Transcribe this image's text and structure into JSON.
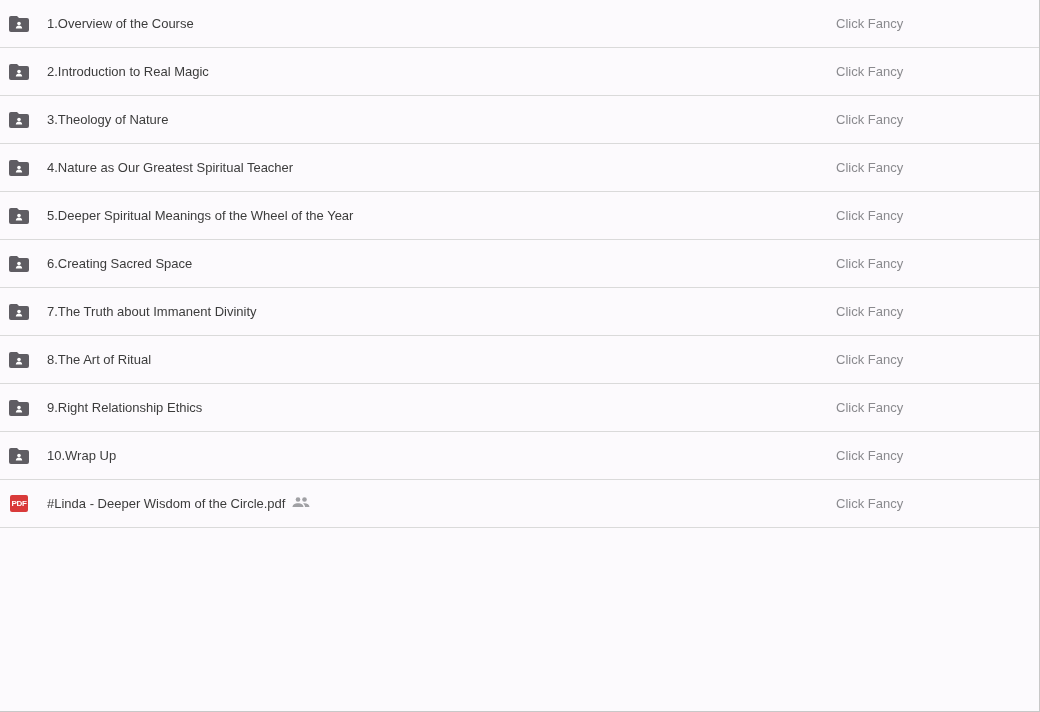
{
  "files": [
    {
      "kind": "folder",
      "name": "1.Overview of the Course",
      "owner": "Click Fancy",
      "shared": false
    },
    {
      "kind": "folder",
      "name": "2.Introduction to Real Magic",
      "owner": "Click Fancy",
      "shared": false
    },
    {
      "kind": "folder",
      "name": "3.Theology of Nature",
      "owner": "Click Fancy",
      "shared": false
    },
    {
      "kind": "folder",
      "name": "4.Nature as Our Greatest Spiritual Teacher",
      "owner": "Click Fancy",
      "shared": false
    },
    {
      "kind": "folder",
      "name": "5.Deeper Spiritual Meanings of the Wheel of the Year",
      "owner": "Click Fancy",
      "shared": false
    },
    {
      "kind": "folder",
      "name": "6.Creating Sacred Space",
      "owner": "Click Fancy",
      "shared": false
    },
    {
      "kind": "folder",
      "name": "7.The Truth about Immanent Divinity",
      "owner": "Click Fancy",
      "shared": false
    },
    {
      "kind": "folder",
      "name": "8.The Art of Ritual",
      "owner": "Click Fancy",
      "shared": false
    },
    {
      "kind": "folder",
      "name": "9.Right Relationship Ethics",
      "owner": "Click Fancy",
      "shared": false
    },
    {
      "kind": "folder",
      "name": "10.Wrap Up",
      "owner": "Click Fancy",
      "shared": false
    },
    {
      "kind": "pdf",
      "icon_text": "PDF",
      "name": "#Linda - Deeper Wisdom of the Circle.pdf",
      "owner": "Click Fancy",
      "shared": true
    }
  ]
}
